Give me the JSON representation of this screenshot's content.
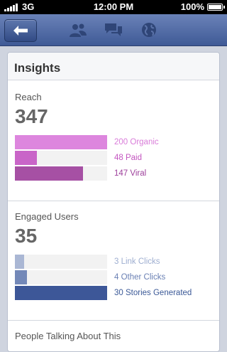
{
  "status_bar": {
    "carrier": "3G",
    "time": "12:00 PM",
    "battery": "100%"
  },
  "nav": {
    "back_icon": "back-arrow-icon",
    "icons": [
      "friends-icon",
      "messages-icon",
      "notifications-globe-icon"
    ]
  },
  "insights": {
    "title": "Insights",
    "reach": {
      "label": "Reach",
      "value": "347",
      "total": 200,
      "bars": [
        {
          "label": "200 Organic",
          "amount": 200,
          "color": "#dd86de",
          "text_color": "#d97cd9"
        },
        {
          "label": "48 Paid",
          "amount": 48,
          "color": "#c965c8",
          "text_color": "#c455c0"
        },
        {
          "label": "147 Viral",
          "amount": 147,
          "color": "#a650a4",
          "text_color": "#9d3f9b"
        }
      ]
    },
    "engaged_users": {
      "label": "Engaged Users",
      "value": "35",
      "total": 30,
      "bars": [
        {
          "label": "3 Link Clicks",
          "amount": 3,
          "color": "#aab7d4",
          "text_color": "#9eaed0"
        },
        {
          "label": "4 Other Clicks",
          "amount": 4,
          "color": "#7388b8",
          "text_color": "#6a80b4"
        },
        {
          "label": "30 Stories Generated",
          "amount": 30,
          "color": "#3d5798",
          "text_color": "#3b5997"
        }
      ]
    },
    "people_talking": {
      "label": "People Talking About This"
    }
  }
}
